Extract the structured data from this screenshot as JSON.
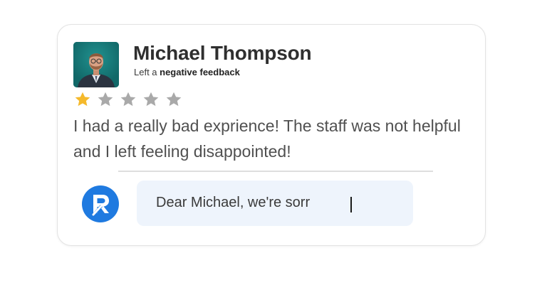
{
  "reviewer": {
    "name": "Michael Thompson",
    "subtitle_prefix": "Left a ",
    "subtitle_emphasis": "negative feedback"
  },
  "rating": {
    "value": 1,
    "max": 5
  },
  "review": {
    "text": "I had a really bad exprience! The staff was not helpful and I left feeling disappointed!"
  },
  "reply": {
    "text": "Dear Michael, we're sorr"
  },
  "colors": {
    "star_filled": "#f5b92b",
    "star_empty": "#a9a9a9",
    "brand_blue": "#1f7ae0",
    "reply_bg": "#eef4fc"
  },
  "icons": {
    "avatar": "avatar-photo",
    "star": "star-icon",
    "brand": "brand-logo-icon"
  }
}
